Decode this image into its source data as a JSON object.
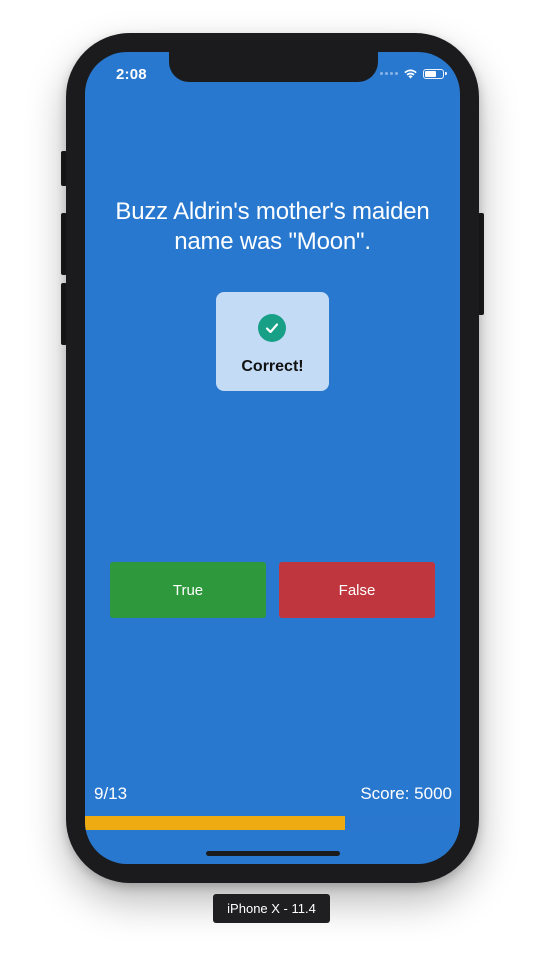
{
  "status_bar": {
    "time": "2:08",
    "wifi_icon": "wifi-icon",
    "battery_icon": "battery-icon"
  },
  "quiz": {
    "question": "Buzz Aldrin's mother's maiden name was \"Moon\".",
    "feedback": {
      "icon": "checkmark-circle-icon",
      "label": "Correct!",
      "icon_color": "#17a085"
    },
    "answers": {
      "true_label": "True",
      "false_label": "False",
      "true_color": "#2e993c",
      "false_color": "#c0363e"
    },
    "progress_text": "9/13",
    "score_text": "Score: 5000",
    "progress_fraction": 0.6923,
    "progress_color": "#eeab12",
    "background_color": "#2878cf"
  },
  "simulator": {
    "device_label": "iPhone X - 11.4"
  }
}
